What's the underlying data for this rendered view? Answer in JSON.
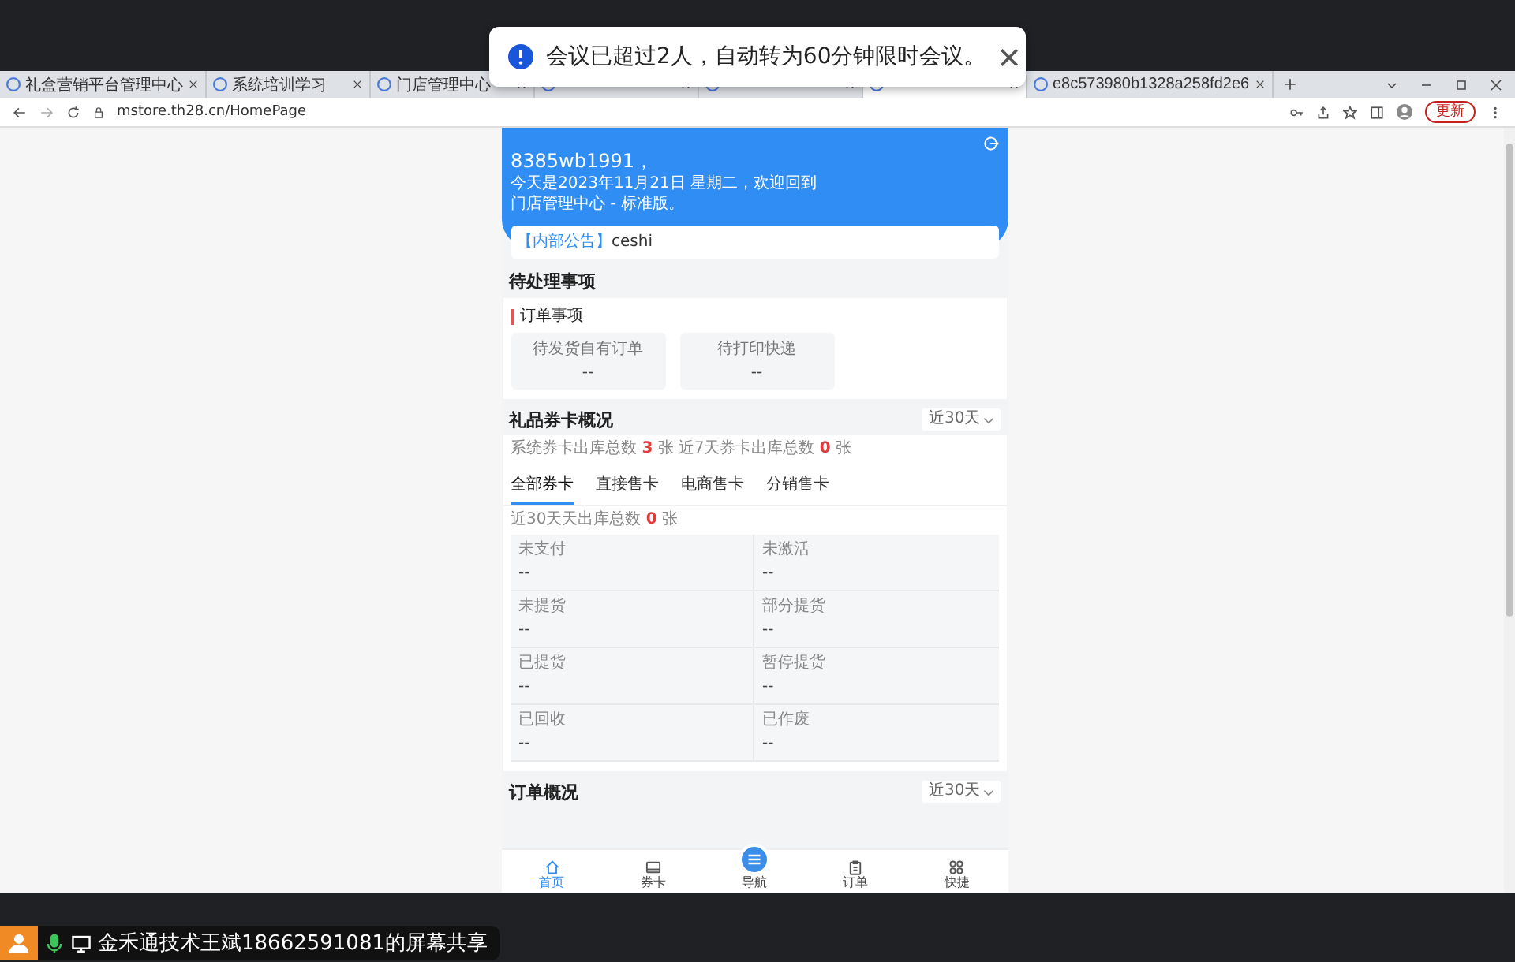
{
  "toast": {
    "text": "会议已超过2人，自动转为60分钟限时会议。"
  },
  "browser": {
    "tabs": [
      {
        "title": "礼盒营销平台管理中心",
        "selected": false
      },
      {
        "title": "系统培训学习",
        "selected": false
      },
      {
        "title": "门店管理中心",
        "selected": false
      },
      {
        "selected": false
      },
      {
        "selected": false
      },
      {
        "selected": true
      },
      {
        "title": "e8c573980b1328a258fd2e6",
        "selected": false
      }
    ],
    "address": "mstore.th28.cn/HomePage",
    "update_button": "更新"
  },
  "header": {
    "username": "8385wb1991，",
    "greeting": "今天是2023年11月21日 星期二，欢迎回到",
    "edition": "门店管理中心 - 标准版。"
  },
  "notice": {
    "tag": "【内部公告】",
    "text": "ceshi"
  },
  "pending": {
    "title": "待处理事项",
    "group_title": "订单事项",
    "items": [
      {
        "label": "待发货自有订单",
        "value": "--"
      },
      {
        "label": "待打印快递",
        "value": "--"
      }
    ]
  },
  "gift_cards": {
    "title": "礼品券卡概况",
    "period": "近30天",
    "stats": [
      {
        "label": "系统券卡出库总数",
        "value": "3",
        "unit": "张"
      },
      {
        "label": "近7天券卡出库总数",
        "value": "0",
        "unit": "张"
      }
    ],
    "tabs": [
      {
        "label": "全部券卡",
        "selected": true
      },
      {
        "label": "直接售卡",
        "selected": false
      },
      {
        "label": "电商售卡",
        "selected": false
      },
      {
        "label": "分销售卡",
        "selected": false
      }
    ],
    "period_total": {
      "label": "近30天天出库总数",
      "value": "0",
      "unit": "张"
    },
    "cells": [
      {
        "label": "未支付",
        "value": "--"
      },
      {
        "label": "未激活",
        "value": "--"
      },
      {
        "label": "未提货",
        "value": "--"
      },
      {
        "label": "部分提货",
        "value": "--"
      },
      {
        "label": "已提货",
        "value": "--"
      },
      {
        "label": "暂停提货",
        "value": "--"
      },
      {
        "label": "已回收",
        "value": "--"
      },
      {
        "label": "已作废",
        "value": "--"
      }
    ]
  },
  "orders": {
    "title": "订单概况",
    "period": "近30天"
  },
  "nav": [
    {
      "label": "首页",
      "selected": true
    },
    {
      "label": "券卡",
      "selected": false
    },
    {
      "label": "导航",
      "selected": false
    },
    {
      "label": "订单",
      "selected": false
    },
    {
      "label": "快捷",
      "selected": false
    }
  ],
  "share_bar": {
    "text": "金禾通技术王斌18662591081的屏幕共享"
  }
}
